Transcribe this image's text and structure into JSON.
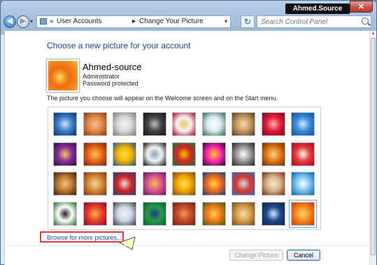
{
  "window": {
    "title_badge": "Ahmed.Source",
    "close_glyph": "✕"
  },
  "nav": {
    "back_glyph": "◀",
    "forward_glyph": "▶",
    "breadcrumb_prefix": "«",
    "breadcrumb": [
      "User Accounts",
      "Change Your Picture"
    ],
    "separator": "▸",
    "dropdown_glyph": "▾",
    "refresh_glyph": "↻",
    "search_placeholder": "Search Control Panel"
  },
  "page": {
    "heading": "Choose a new picture for your account",
    "account": {
      "name": "Ahmed-source",
      "role": "Administrator",
      "password_status": "Password protected"
    },
    "description": "The picture you choose will appear on the Welcome screen and on the Start menu.",
    "browse_link": "Browse for more pictures..."
  },
  "pictures": [
    {
      "icon": "roller-coaster",
      "colors": [
        "#0d2e6b",
        "#3d80c9",
        "#cfe4f7"
      ]
    },
    {
      "icon": "starfish",
      "colors": [
        "#8a3b12",
        "#e0894a",
        "#f5c08c"
      ]
    },
    {
      "icon": "robot",
      "colors": [
        "#7a7a7a",
        "#d8d8d8",
        "#f4f4f4"
      ]
    },
    {
      "icon": "turntable",
      "colors": [
        "#111111",
        "#444444",
        "#bdbdbd"
      ]
    },
    {
      "icon": "lucky-cat",
      "colors": [
        "#b3001b",
        "#f2f2f2",
        "#e8c36a"
      ]
    },
    {
      "icon": "satellite-dish",
      "colors": [
        "#2b6a3e",
        "#d8e8f4",
        "#ffffff"
      ]
    },
    {
      "icon": "kitten",
      "colors": [
        "#5a3a1e",
        "#c79a62",
        "#efd8b6"
      ]
    },
    {
      "icon": "red-flower",
      "colors": [
        "#7a0018",
        "#e21e3a",
        "#ffb0b8"
      ]
    },
    {
      "icon": "snowflake",
      "colors": [
        "#0f4f93",
        "#3b8bd6",
        "#cfeaff"
      ]
    },
    {
      "icon": "ball",
      "colors": [
        "#2b0f3a",
        "#8a2d9c",
        "#f0d04a"
      ]
    },
    {
      "icon": "fabric",
      "colors": [
        "#7b1f0a",
        "#e8681f",
        "#f5c34a"
      ]
    },
    {
      "icon": "leaf",
      "colors": [
        "#1f4f8c",
        "#f2b600",
        "#ffd84a"
      ]
    },
    {
      "icon": "dog",
      "colors": [
        "#111111",
        "#f2f2f2",
        "#8aa6c2"
      ]
    },
    {
      "icon": "crayons",
      "colors": [
        "#0d7a32",
        "#d42424",
        "#f2c200"
      ]
    },
    {
      "icon": "fireworks",
      "colors": [
        "#2a0033",
        "#ff2bb3",
        "#ffd200"
      ]
    },
    {
      "icon": "jacks",
      "colors": [
        "#222222",
        "#9a9a9a",
        "#ffffff"
      ]
    },
    {
      "icon": "stairs",
      "colors": [
        "#6b2a00",
        "#e07a1a",
        "#ffd27a"
      ]
    },
    {
      "icon": "paper-crane",
      "colors": [
        "#a8001a",
        "#e63c3c",
        "#ffffff"
      ]
    },
    {
      "icon": "guitar",
      "colors": [
        "#3b1c0a",
        "#c07a33",
        "#f0c27a"
      ]
    },
    {
      "icon": "puppy",
      "colors": [
        "#7a3a0a",
        "#d98a3a",
        "#f6d4a6"
      ]
    },
    {
      "icon": "robot-toy",
      "colors": [
        "#1f3f7a",
        "#d42424",
        "#e0e0e0"
      ]
    },
    {
      "icon": "rug",
      "colors": [
        "#5a1a6b",
        "#e0558a",
        "#f2c24a"
      ]
    },
    {
      "icon": "sunflower",
      "colors": [
        "#7a4a00",
        "#f2a900",
        "#ffe05a"
      ]
    },
    {
      "icon": "fish",
      "colors": [
        "#0b3f8c",
        "#f26a1a",
        "#ffd24a"
      ]
    },
    {
      "icon": "balloon",
      "colors": [
        "#2a6ab8",
        "#e0362a",
        "#bfe0ff"
      ]
    },
    {
      "icon": "ornament",
      "colors": [
        "#7a2a0a",
        "#d8b48a",
        "#f6e6d0"
      ]
    },
    {
      "icon": "sailboat",
      "colors": [
        "#0a5fa8",
        "#7ec4f2",
        "#ffffff"
      ]
    },
    {
      "icon": "soccer-ball",
      "colors": [
        "#1f6a1f",
        "#ffffff",
        "#222222"
      ]
    },
    {
      "icon": "textile",
      "colors": [
        "#8a0a2a",
        "#e8402a",
        "#f2b84a"
      ]
    },
    {
      "icon": "marbles",
      "colors": [
        "#3a3a3a",
        "#c8d8e8",
        "#f2f2f2"
      ]
    },
    {
      "icon": "window",
      "colors": [
        "#0a5a2a",
        "#2a9a4a",
        "#1a3a8a"
      ]
    },
    {
      "icon": "weave",
      "colors": [
        "#7a1a0a",
        "#c04a2a",
        "#f09a4a"
      ]
    },
    {
      "icon": "butterfly",
      "colors": [
        "#3a5a1a",
        "#f07a1a",
        "#ffd04a"
      ]
    },
    {
      "icon": "spiral",
      "colors": [
        "#6b4a1a",
        "#d8a04a",
        "#f6deb0"
      ]
    },
    {
      "icon": "lighthouse",
      "colors": [
        "#0a1f4a",
        "#1f4a8a",
        "#d8e8ff"
      ]
    },
    {
      "icon": "orange-flower",
      "colors": [
        "#c23a00",
        "#f7891f",
        "#ffd86a"
      ]
    }
  ],
  "selected_picture_index": 35,
  "buttons": {
    "change_picture": "Change Picture",
    "cancel": "Cancel"
  }
}
